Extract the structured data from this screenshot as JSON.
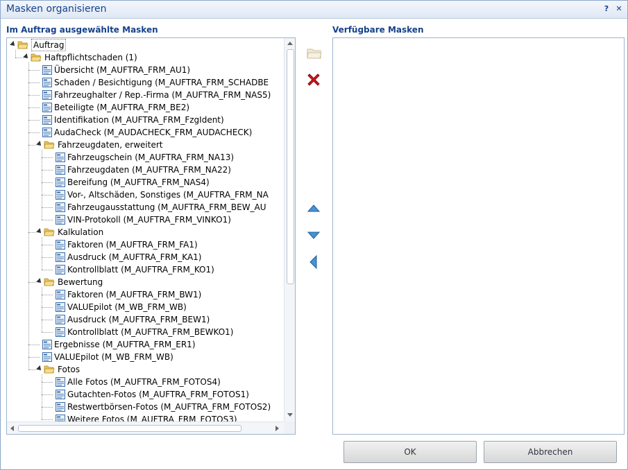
{
  "window": {
    "title": "Masken organisieren",
    "help_label": "?",
    "close_label": "✕"
  },
  "left_panel": {
    "label": "Im Auftrag ausgewählte Masken"
  },
  "right_panel": {
    "label": "Verfügbare Masken"
  },
  "tree": [
    {
      "label": "Auftrag",
      "type": "folder",
      "level": 0,
      "expanded": true,
      "selected": true
    },
    {
      "label": "Haftpflichtschaden (1)",
      "type": "folder",
      "level": 1,
      "expanded": true
    },
    {
      "label": "Übersicht (M_AUFTRA_FRM_AU1)",
      "type": "mask",
      "level": 2
    },
    {
      "label": "Schaden / Besichtigung (M_AUFTRA_FRM_SCHADBE",
      "type": "mask",
      "level": 2
    },
    {
      "label": "Fahrzeughalter / Rep.-Firma (M_AUFTRA_FRM_NAS5)",
      "type": "mask",
      "level": 2
    },
    {
      "label": "Beteiligte (M_AUFTRA_FRM_BE2)",
      "type": "mask",
      "level": 2
    },
    {
      "label": "Identifikation (M_AUFTRA_FRM_FzgIdent)",
      "type": "mask",
      "level": 2
    },
    {
      "label": "AudaCheck (M_AUDACHECK_FRM_AUDACHECK)",
      "type": "mask",
      "level": 2
    },
    {
      "label": "Fahrzeugdaten, erweitert",
      "type": "folder",
      "level": 2,
      "expanded": true
    },
    {
      "label": "Fahrzeugschein (M_AUFTRA_FRM_NA13)",
      "type": "mask",
      "level": 3
    },
    {
      "label": "Fahrzeugdaten (M_AUFTRA_FRM_NA22)",
      "type": "mask",
      "level": 3
    },
    {
      "label": "Bereifung (M_AUFTRA_FRM_NAS4)",
      "type": "mask",
      "level": 3
    },
    {
      "label": "Vor-, Altschäden, Sonstiges (M_AUFTRA_FRM_NA",
      "type": "mask",
      "level": 3
    },
    {
      "label": "Fahrzeugausstattung (M_AUFTRA_FRM_BEW_AU",
      "type": "mask",
      "level": 3
    },
    {
      "label": "VIN-Protokoll (M_AUFTRA_FRM_VINKO1)",
      "type": "mask",
      "level": 3
    },
    {
      "label": "Kalkulation",
      "type": "folder",
      "level": 2,
      "expanded": true
    },
    {
      "label": "Faktoren (M_AUFTRA_FRM_FA1)",
      "type": "mask",
      "level": 3
    },
    {
      "label": "Ausdruck (M_AUFTRA_FRM_KA1)",
      "type": "mask",
      "level": 3
    },
    {
      "label": "Kontrollblatt (M_AUFTRA_FRM_KO1)",
      "type": "mask",
      "level": 3
    },
    {
      "label": "Bewertung",
      "type": "folder",
      "level": 2,
      "expanded": true
    },
    {
      "label": "Faktoren (M_AUFTRA_FRM_BW1)",
      "type": "mask",
      "level": 3
    },
    {
      "label": "VALUEpilot (M_WB_FRM_WB)",
      "type": "mask",
      "level": 3
    },
    {
      "label": "Ausdruck (M_AUFTRA_FRM_BEW1)",
      "type": "mask",
      "level": 3
    },
    {
      "label": "Kontrollblatt (M_AUFTRA_FRM_BEWKO1)",
      "type": "mask",
      "level": 3
    },
    {
      "label": "Ergebnisse (M_AUFTRA_FRM_ER1)",
      "type": "mask",
      "level": 2
    },
    {
      "label": "VALUEpilot (M_WB_FRM_WB)",
      "type": "mask",
      "level": 2
    },
    {
      "label": "Fotos",
      "type": "folder",
      "level": 2,
      "expanded": true
    },
    {
      "label": "Alle Fotos (M_AUFTRA_FRM_FOTOS4)",
      "type": "mask",
      "level": 3
    },
    {
      "label": "Gutachten-Fotos (M_AUFTRA_FRM_FOTOS1)",
      "type": "mask",
      "level": 3
    },
    {
      "label": "Restwertbörsen-Fotos (M_AUFTRA_FRM_FOTOS2)",
      "type": "mask",
      "level": 3
    },
    {
      "label": "Weitere Fotos (M_AUFTRA_FRM_FOTOS3)",
      "type": "mask",
      "level": 3
    }
  ],
  "buttons": {
    "ok": "OK",
    "cancel": "Abbrechen"
  },
  "colors": {
    "title_text": "#15428b",
    "delete_red": "#d2161b",
    "arrow_blue": "#2f78c0",
    "folder_yellow": "#f2cf6b"
  }
}
